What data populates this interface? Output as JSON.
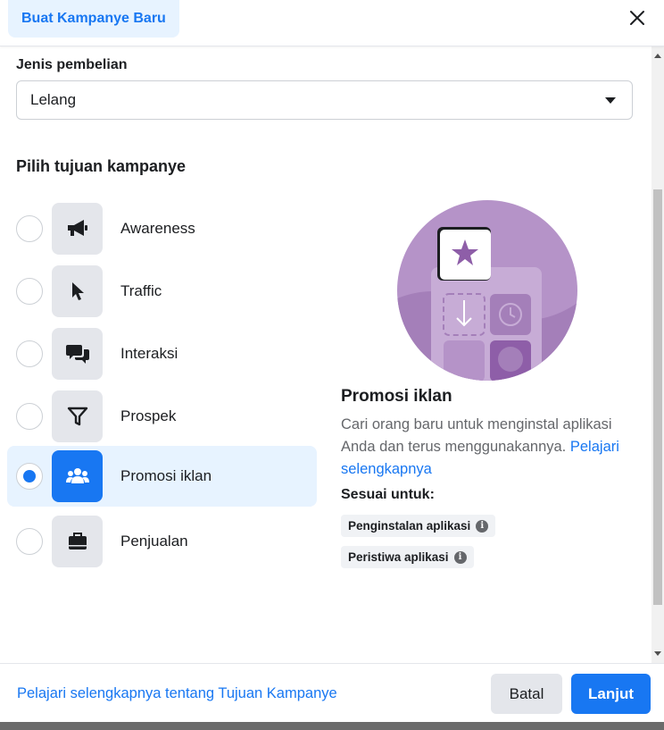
{
  "header": {
    "title": "Buat Kampanye Baru",
    "close_icon": "close-icon"
  },
  "purchase": {
    "label": "Jenis pembelian",
    "value": "Lelang"
  },
  "objectives": {
    "title": "Pilih tujuan kampanye",
    "selected_index": 4,
    "items": [
      {
        "label": "Awareness",
        "icon": "megaphone-icon"
      },
      {
        "label": "Traffic",
        "icon": "cursor-icon"
      },
      {
        "label": "Interaksi",
        "icon": "chat-bubbles-icon"
      },
      {
        "label": "Prospek",
        "icon": "funnel-icon"
      },
      {
        "label": "Promosi iklan",
        "icon": "people-icon"
      },
      {
        "label": "Penjualan",
        "icon": "briefcase-icon"
      }
    ]
  },
  "detail": {
    "title": "Promosi iklan",
    "description": "Cari orang baru untuk menginstal aplikasi Anda dan terus menggunakannya.",
    "learn_more": "Pelajari selengkapnya",
    "fit_title": "Sesuai untuk:",
    "tags": [
      "Penginstalan aplikasi",
      "Peristiwa aplikasi"
    ]
  },
  "footer": {
    "link": "Pelajari selengkapnya tentang Tujuan Kampanye",
    "cancel": "Batal",
    "next": "Lanjut"
  },
  "colors": {
    "accent": "#1877f2",
    "selected_bg": "#e7f3ff",
    "illustration": "#b593c8"
  }
}
